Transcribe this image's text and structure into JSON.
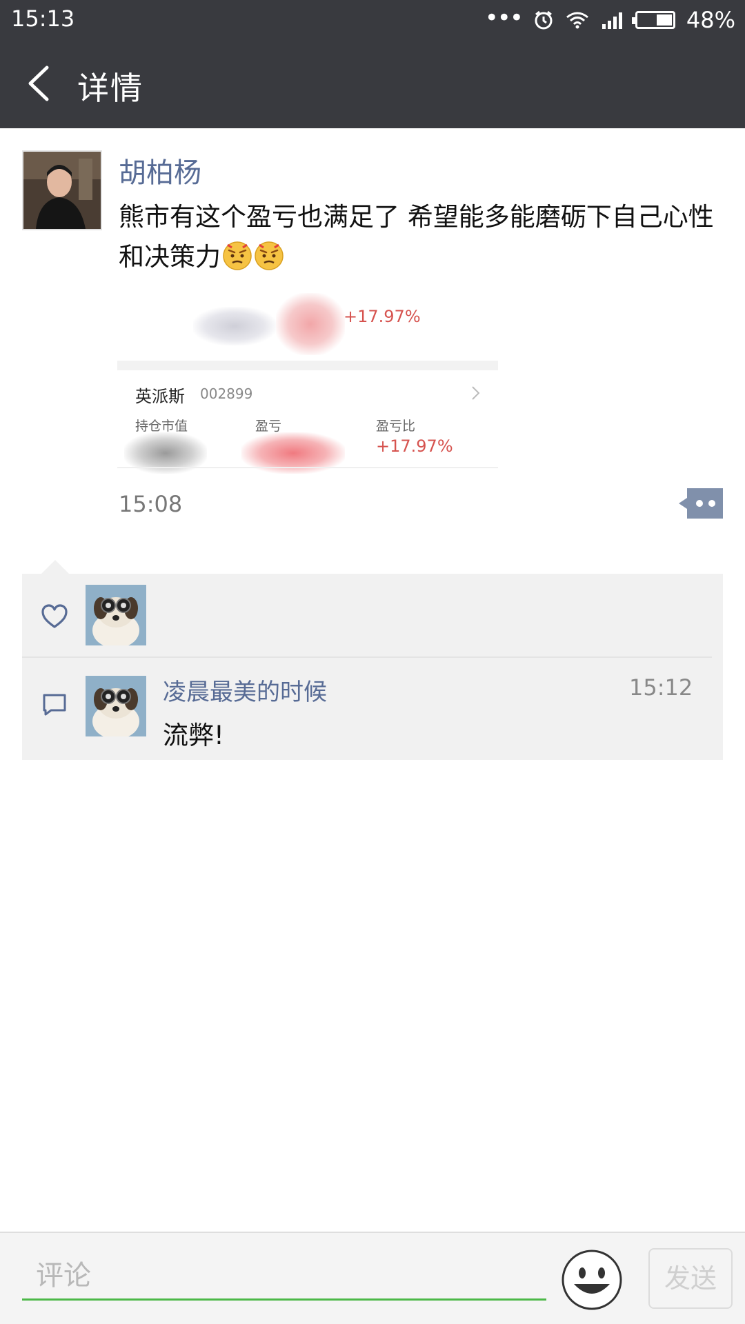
{
  "status_bar": {
    "time": "15:13",
    "battery_text": "48%",
    "battery_level": 0.48,
    "icons": [
      "more-dots-icon",
      "alarm-icon",
      "wifi-icon",
      "signal-icon",
      "battery-icon"
    ]
  },
  "header": {
    "back_icon": "chevron-left-icon",
    "title": "详情"
  },
  "post": {
    "author": "胡柏杨",
    "text": "熊市有这个盈亏也满足了 希望能多能磨砺下自己心性和决策力",
    "emoji_icons": [
      "angry-face-icon",
      "angry-face-icon"
    ],
    "time": "15:08",
    "image": {
      "top_percent": "+17.97%",
      "stock_name": "英派斯",
      "stock_code": "002899",
      "col_market_value": "持仓市值",
      "col_profit": "盈亏",
      "col_profit_ratio": "盈亏比",
      "profit_ratio_value": "+17.97%"
    }
  },
  "interactions": {
    "like_icon": "heart-icon",
    "comment_icon": "comment-icon",
    "comments": [
      {
        "author": "凌晨最美的时候",
        "time": "15:12",
        "text": "流弊!"
      }
    ]
  },
  "input_bar": {
    "placeholder": "评论",
    "emoji_icon": "smiley-icon",
    "send_label": "发送"
  },
  "colors": {
    "header_bg": "#393a3f",
    "link_blue": "#576b95",
    "accent_green": "#4cb848",
    "gain_red": "#d6534f",
    "panel_bg": "#f1f1f1"
  }
}
